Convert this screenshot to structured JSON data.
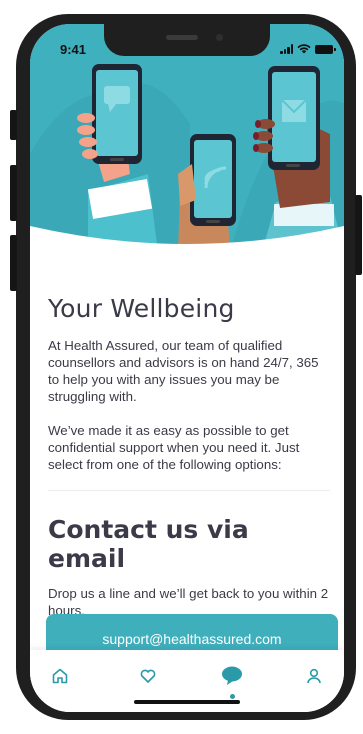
{
  "status_bar": {
    "time": "9:41"
  },
  "wellbeing": {
    "title": "Your Wellbeing",
    "intro": "At Health Assured, our team of qualified counsellors and advisors is on hand 24/7, 365 to help you with any issues you may be struggling with.",
    "options_text": "We’ve made it as easy as possible to get confidential support when you need it. Just select from one of the following options:"
  },
  "email_section": {
    "title": "Contact us via email",
    "description": "Drop us a line and we’ll get back to you within 2 hours.",
    "email_button": "support@healthassured.com"
  },
  "tab_bar": {
    "tabs": [
      {
        "icon": "home-icon",
        "active": false
      },
      {
        "icon": "heart-icon",
        "active": false
      },
      {
        "icon": "chat-bubble-icon",
        "active": true
      },
      {
        "icon": "user-icon",
        "active": false
      }
    ]
  },
  "colors": {
    "accent": "#3fb0bd",
    "button": "#3fafbc",
    "active_tab": "#2a9aa8",
    "text": "#3b3b47"
  }
}
